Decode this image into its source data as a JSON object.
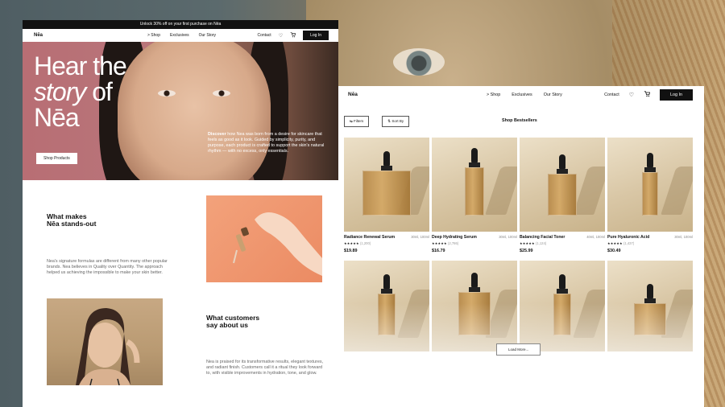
{
  "promo_bar": "Unlock 30% off on your first purchase on Nēa",
  "left_page": {
    "logo": "Nēa",
    "nav": [
      "> Shop",
      "Exclusives",
      "Our Story"
    ],
    "contact": "Contact",
    "login": "Log In",
    "hero": {
      "line1": "Hear the",
      "line2_italic": "story",
      "line2_rest": " of",
      "line3": "Nēa",
      "desc_bold": "Discover",
      "desc_rest": " how Nea was born from a desire for skincare that feels as good as it look. Guided by simplicity, purity, and purpose, each product is crafted to support the skin's natural rhythm — with no excess, only essentials.",
      "cta": "Shop Products"
    },
    "section1": {
      "title": "What makes\nNēa stands-out",
      "text": "Nea's signature formulas are different from many other popular brands. Nea believes in Quality over Quantity. The approach helped us achieving the impossible to make your skin better."
    },
    "section2": {
      "title": "What customers\nsay about us",
      "text": "Nea is praised for its transformative results, elegant textures, and radiant finish. Customers call it a ritual they look forward to, with visible improvements in hydration, tone, and glow."
    }
  },
  "right_page": {
    "logo": "Nēa",
    "nav": [
      "> Shop",
      "Exclusives",
      "Our Story"
    ],
    "contact": "Contact",
    "login": "Log In",
    "filters": "Filters",
    "sort": "Sort By",
    "title": "Shop Bestsellers",
    "products": [
      {
        "name": "Radiance Renewal Serum",
        "size": "30ml, 100ml",
        "stars": "★★★★★",
        "reviews": "(1,200)",
        "price": "$19.89"
      },
      {
        "name": "Deep Hydrating Serum",
        "size": "30ml, 100ml",
        "stars": "★★★★★",
        "reviews": "(2,786)",
        "price": "$16.79"
      },
      {
        "name": "Balancing Facial Toner",
        "size": "40ml, 100ml",
        "stars": "★★★★★",
        "reviews": "(1,124)",
        "price": "$25.99"
      },
      {
        "name": "Pure Hyaluronic Acid",
        "size": "30ml, 100ml",
        "stars": "★★★★★",
        "reviews": "(1,437)",
        "price": "$30.49"
      }
    ],
    "load_more": "Load More..."
  },
  "icons": {
    "wishlist": "heart-icon",
    "cart": "cart-icon",
    "filters": "filter-icon",
    "sort": "sort-icon"
  }
}
